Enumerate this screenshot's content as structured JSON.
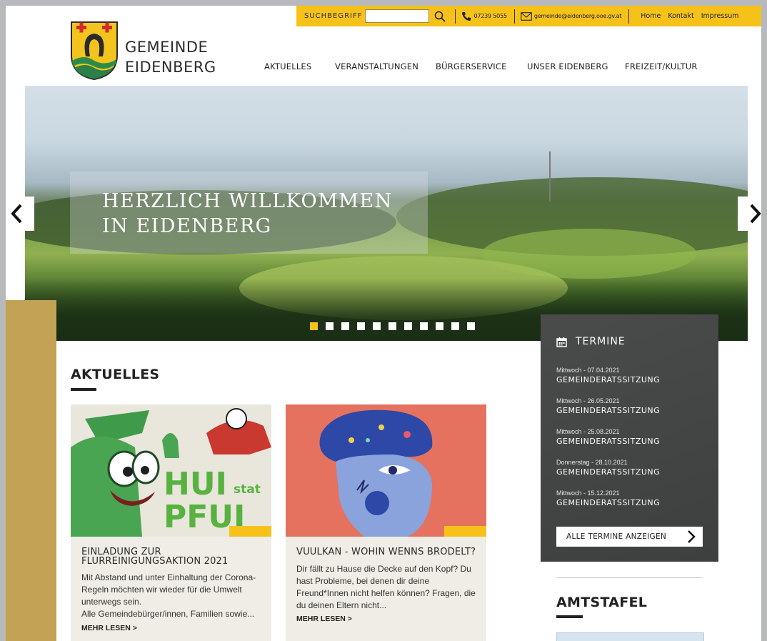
{
  "topbar": {
    "search_label": "SUCHBEGRIFF",
    "search_value": "",
    "phone": "07239 5055",
    "email": "gemeinde@eidenberg.ooe.gv.at",
    "links": [
      "Home",
      "Kontakt",
      "Impressum"
    ]
  },
  "brand": {
    "line1": "GEMEINDE",
    "line2": "EIDENBERG"
  },
  "nav": [
    "AKTUELLES",
    "VERANSTALTUNGEN",
    "BÜRGERSERVICE",
    "UNSER EIDENBERG",
    "FREIZEIT/KULTUR"
  ],
  "hero": {
    "title": "HERZLICH WILLKOMMEN IN EIDENBERG",
    "slide_count": 11,
    "active_slide": 1
  },
  "aktuelles": {
    "title": "AKTUELLES",
    "cards": [
      {
        "title": "EINLADUNG ZUR FLURREINIGUNGSAKTION 2021",
        "text": "Mit Abstand und unter Einhaltung der Corona-Regeln möchten wir wieder für die Umwelt unterwegs sein.",
        "text2": "Alle Gemeindebürger/innen, Familien sowie...",
        "more": "MEHR LESEN >",
        "img_text1": "HUI",
        "img_text2": "stat",
        "img_text3": "PFUI"
      },
      {
        "title": "VUULKAN - WOHIN WENNS BRODELT?",
        "text": "Dir fällt zu Hause die Decke auf den Kopf? Du hast Probleme, bei denen dir deine Freund*Innen nicht helfen können? Fragen, die du deinen Eltern nicht...",
        "more": "MEHR LESEN >"
      }
    ]
  },
  "termine": {
    "title": "TERMINE",
    "items": [
      {
        "date": "Mittwoch - 07.04.2021",
        "name": "GEMEINDERATSSITZUNG"
      },
      {
        "date": "Mittwoch - 26.05.2021",
        "name": "GEMEINDERATSSITZUNG"
      },
      {
        "date": "Mittwoch - 25.08.2021",
        "name": "GEMEINDERATSSITZUNG"
      },
      {
        "date": "Donnerstag - 28.10.2021",
        "name": "GEMEINDERATSSITZUNG"
      },
      {
        "date": "Mittwoch - 15.12.2021",
        "name": "GEMEINDERATSSITZUNG"
      }
    ],
    "all_label": "ALLE TERMINE ANZEIGEN"
  },
  "amtstafel": {
    "title": "AMTSTAFEL"
  },
  "colors": {
    "accent": "#f6c21a",
    "gold_side": "#c2a254",
    "termine_bg": "#444545",
    "card_bg": "#efede6"
  },
  "icons": [
    "search-icon",
    "phone-icon",
    "mail-icon",
    "calendar-icon",
    "chevron-left-icon",
    "chevron-right-icon"
  ]
}
